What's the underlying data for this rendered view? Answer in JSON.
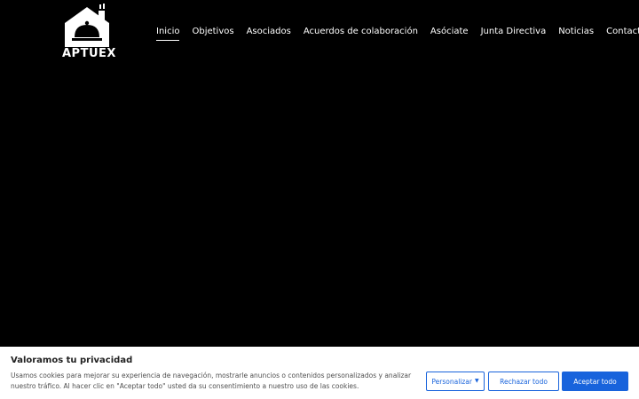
{
  "brand": {
    "name": "APTUEX",
    "logo_icon": "house-cloche-icon"
  },
  "nav": {
    "items": [
      {
        "label": "Inicio",
        "active": true
      },
      {
        "label": "Objetivos"
      },
      {
        "label": "Asociados"
      },
      {
        "label": "Acuerdos de colaboración"
      },
      {
        "label": "Asóciate"
      },
      {
        "label": "Junta Directiva"
      },
      {
        "label": "Noticias"
      },
      {
        "label": "Contacto"
      }
    ]
  },
  "cookie_banner": {
    "title": "Valoramos tu privacidad",
    "text": "Usamos cookies para mejorar su experiencia de navegación, mostrarle anuncios o contenidos personalizados y analizar nuestro tráfico. Al hacer clic en \"Aceptar todo\" usted da su consentimiento a nuestro uso de las cookies.",
    "customize_label": "Personalizar",
    "reject_label": "Rechazar todo",
    "accept_label": "Aceptar todo",
    "accent_color": "#1863dc"
  }
}
